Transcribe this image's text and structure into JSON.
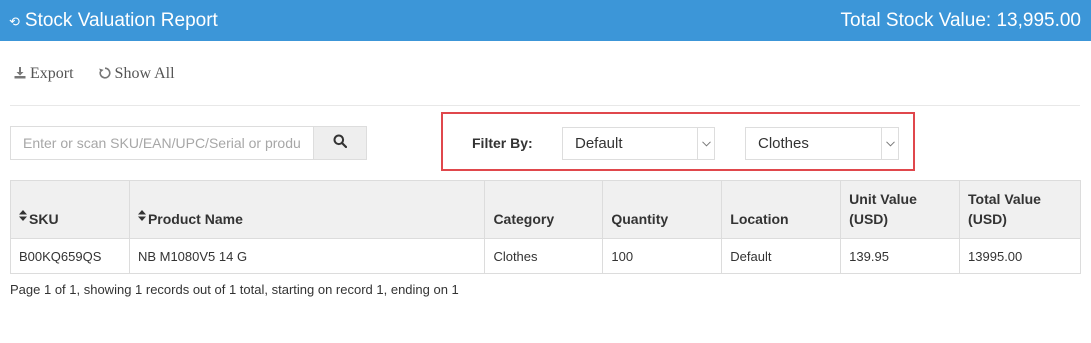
{
  "header": {
    "title": "Stock Valuation Report",
    "total_label": "Total Stock Value: 13,995.00",
    "bg_color": "#3c96d8"
  },
  "toolbar": {
    "export_label": "Export",
    "show_all_label": "Show All"
  },
  "search": {
    "placeholder": "Enter or scan SKU/EAN/UPC/Serial or product name",
    "value": ""
  },
  "filter": {
    "label": "Filter By:",
    "selects": [
      "Default",
      "Clothes"
    ],
    "highlight_color": "#e0474c"
  },
  "table": {
    "columns": [
      {
        "label": "SKU",
        "sortable": true
      },
      {
        "label": "Product Name",
        "sortable": true
      },
      {
        "label": "Category",
        "sortable": false
      },
      {
        "label": "Quantity",
        "sortable": false
      },
      {
        "label": "Location",
        "sortable": false
      },
      {
        "label": "Unit Value (USD)",
        "sortable": false
      },
      {
        "label": "Total Value (USD)",
        "sortable": false
      }
    ],
    "rows": [
      [
        "B00KQ659QS",
        "NB M1080V5 14 G",
        "Clothes",
        "100",
        "Default",
        "139.95",
        "13995.00"
      ]
    ]
  },
  "pager": {
    "text": "Page 1 of 1, showing 1 records out of 1 total, starting on record 1, ending on 1"
  }
}
